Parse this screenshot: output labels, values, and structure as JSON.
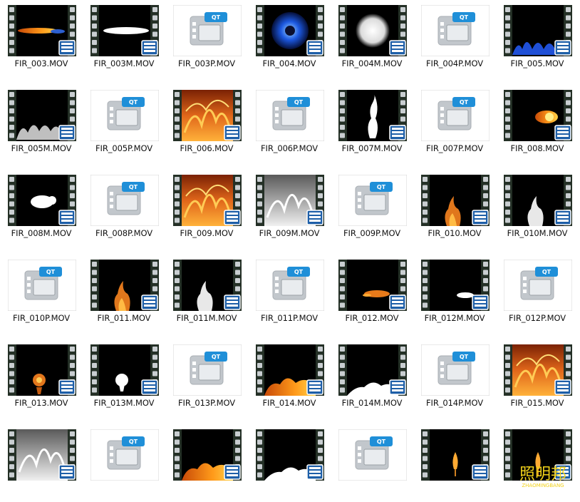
{
  "columns": 7,
  "files": [
    {
      "name": "FIR_003.MOV",
      "kind": "video",
      "art": "streak-orange"
    },
    {
      "name": "FIR_003M.MOV",
      "kind": "video",
      "art": "streak-white"
    },
    {
      "name": "FIR_003P.MOV",
      "kind": "qt",
      "art": "qt"
    },
    {
      "name": "FIR_004.MOV",
      "kind": "video",
      "art": "blue-ball"
    },
    {
      "name": "FIR_004M.MOV",
      "kind": "video",
      "art": "white-ball"
    },
    {
      "name": "FIR_004P.MOV",
      "kind": "qt",
      "art": "qt"
    },
    {
      "name": "FIR_005.MOV",
      "kind": "video",
      "art": "blue-flames-bottom"
    },
    {
      "name": "FIR_005M.MOV",
      "kind": "video",
      "art": "white-mist-bottom"
    },
    {
      "name": "FIR_005P.MOV",
      "kind": "qt",
      "art": "qt"
    },
    {
      "name": "FIR_006.MOV",
      "kind": "video",
      "art": "fire-full"
    },
    {
      "name": "FIR_006P.MOV",
      "kind": "qt",
      "art": "qt"
    },
    {
      "name": "FIR_007M.MOV",
      "kind": "video",
      "art": "white-column"
    },
    {
      "name": "FIR_007P.MOV",
      "kind": "qt",
      "art": "qt"
    },
    {
      "name": "FIR_008.MOV",
      "kind": "video",
      "art": "fireball-right"
    },
    {
      "name": "FIR_008M.MOV",
      "kind": "video",
      "art": "white-blob"
    },
    {
      "name": "FIR_008P.MOV",
      "kind": "qt",
      "art": "qt"
    },
    {
      "name": "FIR_009.MOV",
      "kind": "video",
      "art": "fire-full"
    },
    {
      "name": "FIR_009M.MOV",
      "kind": "video",
      "art": "white-full"
    },
    {
      "name": "FIR_009P.MOV",
      "kind": "qt",
      "art": "qt"
    },
    {
      "name": "FIR_010.MOV",
      "kind": "video",
      "art": "small-flame"
    },
    {
      "name": "FIR_010M.MOV",
      "kind": "video",
      "art": "small-white-flame"
    },
    {
      "name": "FIR_010P.MOV",
      "kind": "qt",
      "art": "qt"
    },
    {
      "name": "FIR_011.MOV",
      "kind": "video",
      "art": "small-flame"
    },
    {
      "name": "FIR_011M.MOV",
      "kind": "video",
      "art": "small-white-flame"
    },
    {
      "name": "FIR_011P.MOV",
      "kind": "qt",
      "art": "qt"
    },
    {
      "name": "FIR_012.MOV",
      "kind": "video",
      "art": "streak-low"
    },
    {
      "name": "FIR_012M.MOV",
      "kind": "video",
      "art": "white-streak-low"
    },
    {
      "name": "FIR_012P.MOV",
      "kind": "qt",
      "art": "qt"
    },
    {
      "name": "FIR_013.MOV",
      "kind": "video",
      "art": "small-burst"
    },
    {
      "name": "FIR_013M.MOV",
      "kind": "video",
      "art": "white-burst"
    },
    {
      "name": "FIR_013P.MOV",
      "kind": "qt",
      "art": "qt"
    },
    {
      "name": "FIR_014.MOV",
      "kind": "video",
      "art": "fire-bottom"
    },
    {
      "name": "FIR_014M.MOV",
      "kind": "video",
      "art": "white-bottom"
    },
    {
      "name": "FIR_014P.MOV",
      "kind": "qt",
      "art": "qt"
    },
    {
      "name": "FIR_015.MOV",
      "kind": "video",
      "art": "fire-full"
    },
    {
      "name": "",
      "kind": "video",
      "art": "white-full"
    },
    {
      "name": "",
      "kind": "qt",
      "art": "qt"
    },
    {
      "name": "",
      "kind": "video",
      "art": "fire-bottom"
    },
    {
      "name": "",
      "kind": "video",
      "art": "white-bottom"
    },
    {
      "name": "",
      "kind": "qt",
      "art": "qt"
    },
    {
      "name": "",
      "kind": "video",
      "art": "candle"
    },
    {
      "name": "",
      "kind": "video",
      "art": "candle"
    }
  ],
  "icons": {
    "video": "video-file-icon",
    "qt": "quicktime-file-icon"
  },
  "qt_badge": "QT",
  "watermark": {
    "cn": "照明邦",
    "en": "ZHAOMINGBANG"
  }
}
